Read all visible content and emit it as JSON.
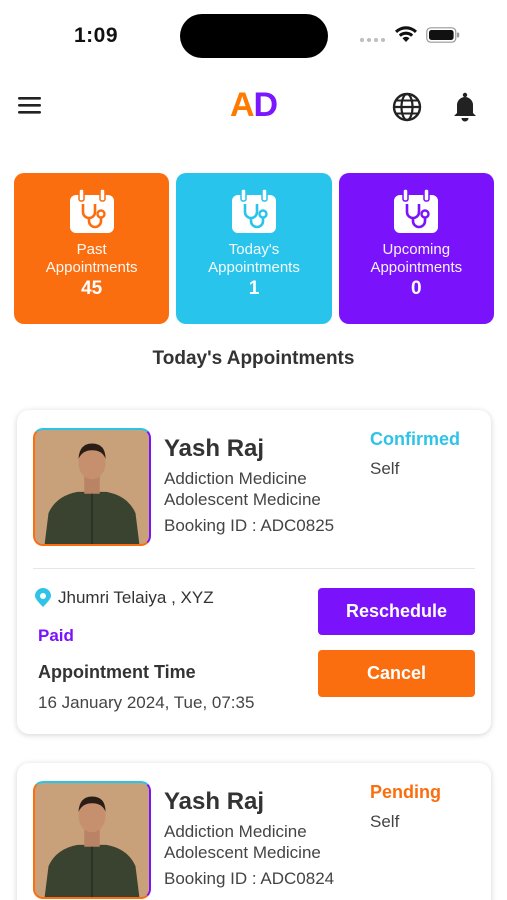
{
  "status_bar": {
    "time": "1:09"
  },
  "header": {
    "logo_first": "A",
    "logo_second": "D",
    "logo_colors": {
      "first": "#ff7a00",
      "second": "#7b16ff"
    },
    "icons": [
      "menu-icon",
      "globe-icon",
      "bell-icon"
    ]
  },
  "stats": [
    {
      "label_line1": "Past",
      "label_line2": "Appointments",
      "count": "45",
      "color": "#fb6e0f",
      "icon": "calendar-stethoscope-icon"
    },
    {
      "label_line1": "Today's",
      "label_line2": "Appointments",
      "count": "1",
      "color": "#29c4ec",
      "icon": "calendar-stethoscope-icon"
    },
    {
      "label_line1": "Upcoming",
      "label_line2": "Appointments",
      "count": "0",
      "color": "#7a12fb",
      "icon": "calendar-stethoscope-icon"
    }
  ],
  "section_title": "Today's Appointments",
  "appointments": [
    {
      "name": "Yash Raj",
      "specialties": [
        "Addiction Medicine",
        "Adolescent Medicine"
      ],
      "booking_id": "Booking ID : ADC0825",
      "status": "Confirmed",
      "for_whom": "Self",
      "location": "Jhumri Telaiya , XYZ",
      "payment": "Paid",
      "time_label": "Appointment Time",
      "time": "16 January 2024, Tue, 07:35",
      "reschedule_label": "Reschedule",
      "cancel_label": "Cancel"
    },
    {
      "name": "Yash Raj",
      "specialties": [
        "Addiction Medicine",
        "Adolescent Medicine"
      ],
      "booking_id": "Booking ID : ADC0824",
      "status": "Pending",
      "for_whom": "Self"
    }
  ]
}
